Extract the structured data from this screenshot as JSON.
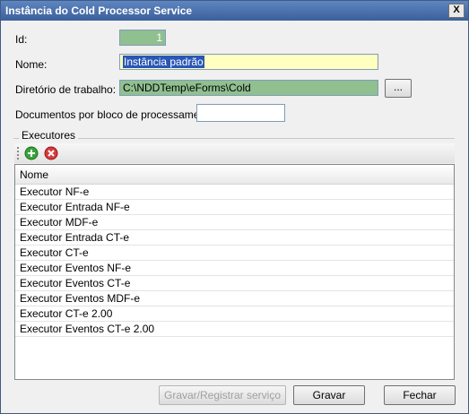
{
  "window": {
    "title": "Instância do Cold Processor Service",
    "close_label": "X"
  },
  "form": {
    "id_label": "Id:",
    "id_value": "1",
    "nome_label": "Nome:",
    "nome_value": "Instância padrão",
    "dir_label": "Diretório de trabalho:",
    "dir_value": "C:\\NDDTemp\\eForms\\Cold",
    "browse_label": "...",
    "docs_label": "Documentos por bloco de processamento:",
    "docs_value": ""
  },
  "executores": {
    "group_label": "Executores",
    "column_header": "Nome",
    "rows": [
      "Executor NF-e",
      "Executor Entrada NF-e",
      "Executor MDF-e",
      "Executor Entrada CT-e",
      "Executor CT-e",
      "Executor Eventos NF-e",
      "Executor Eventos CT-e",
      "Executor Eventos MDF-e",
      "Executor CT-e 2.00",
      "Executor Eventos CT-e 2.00"
    ]
  },
  "buttons": {
    "register": "Gravar/Registrar serviço",
    "save": "Gravar",
    "close": "Fechar"
  },
  "icons": {
    "add": "add-icon",
    "delete": "delete-icon"
  }
}
